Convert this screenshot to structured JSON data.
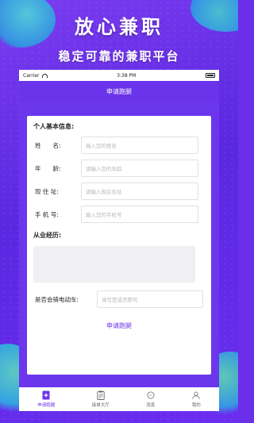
{
  "banner": {
    "headline": "放心兼职",
    "subline": "稳定可靠的兼职平台"
  },
  "statusbar": {
    "carrier": "Carrier",
    "time": "3:38 PM"
  },
  "navbar": {
    "title": "申请跑腿"
  },
  "form": {
    "section_title": "个人基本信息:",
    "fields": [
      {
        "label": "姓　　名:",
        "placeholder": "输入您的姓名"
      },
      {
        "label": "年　　龄:",
        "placeholder": "请输入您的年龄"
      },
      {
        "label": "现 住 址:",
        "placeholder": "请输入现在住址"
      },
      {
        "label": "手 机 号:",
        "placeholder": "输入您的手机号"
      }
    ],
    "experience_title": "从业经历:",
    "ebike": {
      "label": "是否会骑电动车:",
      "placeholder": "填写是或否即可"
    }
  },
  "submit_label": "申请跑腿",
  "tabbar": {
    "items": [
      {
        "label": "申请跑腿",
        "icon": "plus-document-icon",
        "active": true
      },
      {
        "label": "接单大厅",
        "icon": "clipboard-icon",
        "active": false
      },
      {
        "label": "消息",
        "icon": "chat-bubble-icon",
        "active": false
      },
      {
        "label": "我的",
        "icon": "person-icon",
        "active": false
      }
    ]
  },
  "colors": {
    "accent": "#6b33ea",
    "background": "#6a2fe8"
  }
}
